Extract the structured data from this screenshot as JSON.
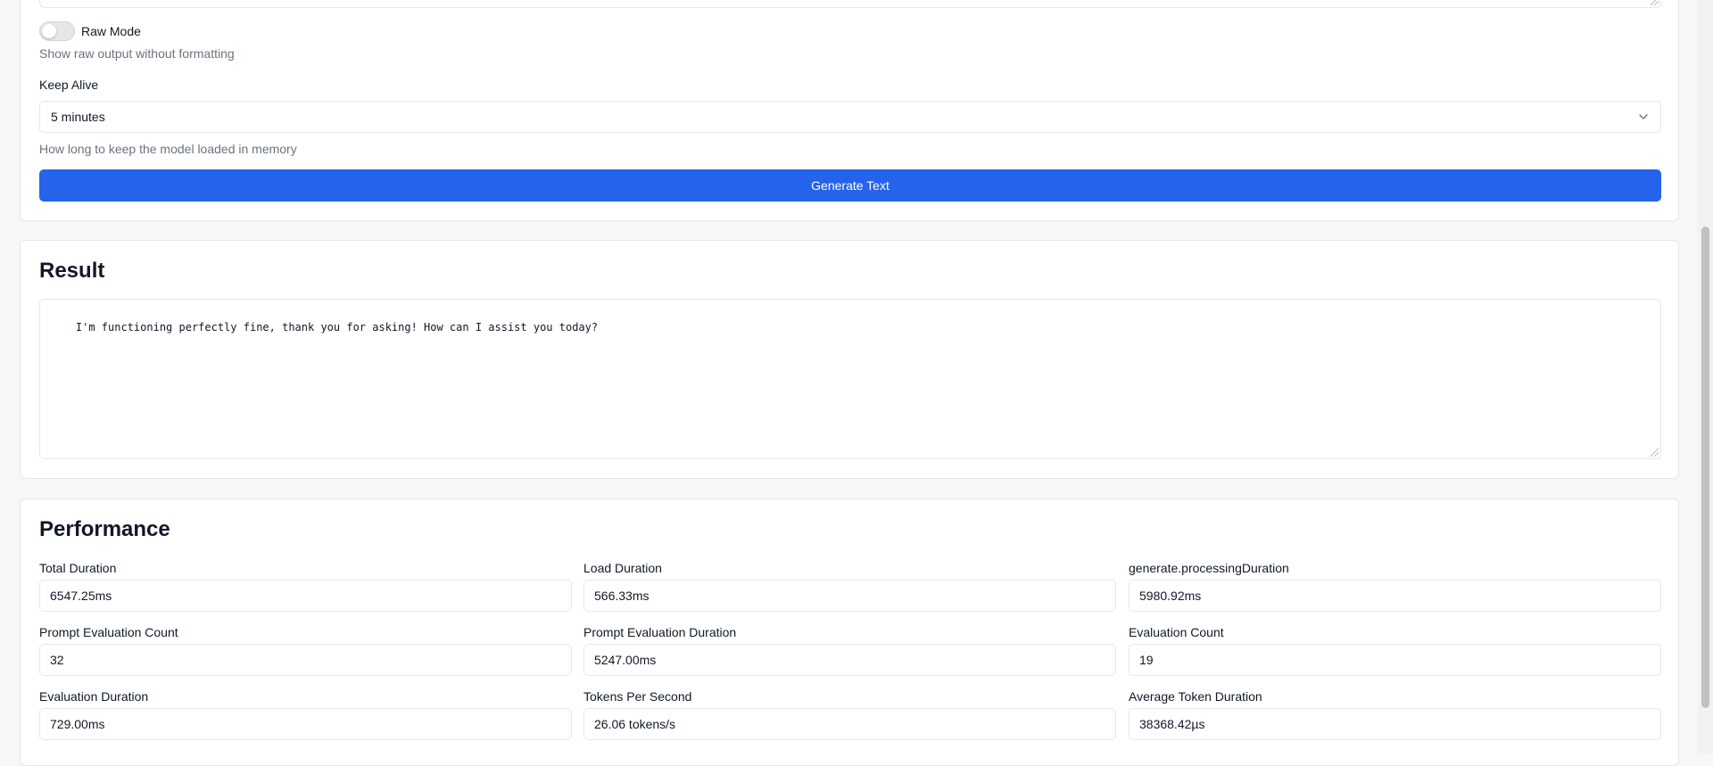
{
  "settings": {
    "raw_mode_label": "Raw Mode",
    "raw_mode_enabled": false,
    "raw_mode_help": "Show raw output without formatting",
    "keep_alive_label": "Keep Alive",
    "keep_alive_value": "5 minutes",
    "keep_alive_help": "How long to keep the model loaded in memory",
    "generate_button": "Generate Text"
  },
  "result": {
    "title": "Result",
    "text": "I'm functioning perfectly fine, thank you for asking! How can I assist you today?"
  },
  "performance": {
    "title": "Performance",
    "metrics": [
      {
        "label": "Total Duration",
        "value": "6547.25ms"
      },
      {
        "label": "Load Duration",
        "value": "566.33ms"
      },
      {
        "label": "generate.processingDuration",
        "value": "5980.92ms"
      },
      {
        "label": "Prompt Evaluation Count",
        "value": "32"
      },
      {
        "label": "Prompt Evaluation Duration",
        "value": "5247.00ms"
      },
      {
        "label": "Evaluation Count",
        "value": "19"
      },
      {
        "label": "Evaluation Duration",
        "value": "729.00ms"
      },
      {
        "label": "Tokens Per Second",
        "value": "26.06 tokens/s"
      },
      {
        "label": "Average Token Duration",
        "value": "38368.42µs"
      }
    ]
  },
  "icons": {
    "select_chevron": "chevron-down-icon",
    "textarea_resize": "resize-grip-icon"
  },
  "colors": {
    "primary": "#2563eb",
    "page_background": "#f6f7f9",
    "card_border": "#e5e7eb",
    "muted_text": "#6b7280"
  }
}
